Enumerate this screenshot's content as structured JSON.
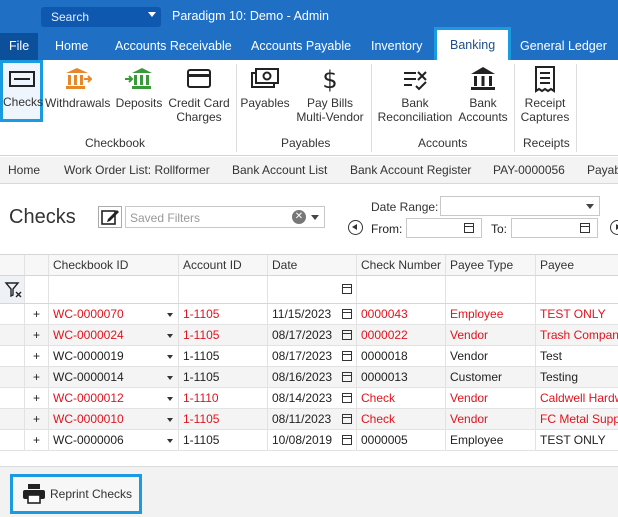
{
  "header": {
    "search_label": "Search",
    "app_title": "Paradigm 10: Demo - Admin"
  },
  "menu": {
    "items": [
      "File",
      "Home",
      "Accounts Receivable",
      "Accounts Payable",
      "Inventory",
      "Banking",
      "General Ledger"
    ],
    "active": "Banking"
  },
  "ribbon": {
    "buttons": [
      {
        "label": "Checks"
      },
      {
        "label": "Withdrawals"
      },
      {
        "label": "Deposits"
      },
      {
        "label": "Credit Card",
        "label2": "Charges"
      },
      {
        "label": "Payables"
      },
      {
        "label": "Pay Bills",
        "label2": "Multi-Vendor"
      },
      {
        "label": "Bank",
        "label2": "Reconciliation"
      },
      {
        "label": "Bank",
        "label2": "Accounts"
      },
      {
        "label": "Receipt",
        "label2": "Captures"
      }
    ],
    "groups": [
      "Checkbook",
      "Payables",
      "Accounts",
      "Receipts"
    ]
  },
  "breadcrumbs": [
    "Home",
    "Work Order List: Rollformer",
    "Bank Account List",
    "Bank Account Register",
    "PAY-0000056",
    "Payab"
  ],
  "page": {
    "title": "Checks",
    "filters_placeholder": "Saved Filters",
    "date_range_label": "Date Range:",
    "from_label": "From:",
    "to_label": "To:"
  },
  "grid": {
    "columns": [
      "Checkbook ID",
      "Account ID",
      "Date",
      "Check Number",
      "Payee Type",
      "Payee"
    ],
    "rows": [
      {
        "checkbook": "WC-0000070",
        "account": "1-1105",
        "date": "11/15/2023",
        "check": "0000043",
        "payee_type": "Employee",
        "payee": "TEST ONLY",
        "red": true
      },
      {
        "checkbook": "WC-0000024",
        "account": "1-1105",
        "date": "08/17/2023",
        "check": "0000022",
        "payee_type": "Vendor",
        "payee": "Trash Company",
        "red": true
      },
      {
        "checkbook": "WC-0000019",
        "account": "1-1105",
        "date": "08/17/2023",
        "check": "0000018",
        "payee_type": "Vendor",
        "payee": "Test",
        "red": false
      },
      {
        "checkbook": "WC-0000014",
        "account": "1-1105",
        "date": "08/16/2023",
        "check": "0000013",
        "payee_type": "Customer",
        "payee": "Testing",
        "red": false
      },
      {
        "checkbook": "WC-0000012",
        "account": "1-1110",
        "date": "08/14/2023",
        "check": "Check",
        "payee_type": "Vendor",
        "payee": "Caldwell Hardw",
        "red": true
      },
      {
        "checkbook": "WC-0000010",
        "account": "1-1105",
        "date": "08/11/2023",
        "check": "Check",
        "payee_type": "Vendor",
        "payee": "FC Metal Supp",
        "red": true
      },
      {
        "checkbook": "WC-0000006",
        "account": "1-1105",
        "date": "10/08/2019",
        "check": "0000005",
        "payee_type": "Employee",
        "payee": "TEST  ONLY",
        "red": false
      }
    ]
  },
  "footer": {
    "reprint_label": "Reprint Checks"
  },
  "colors": {
    "brand_blue": "#1f6fc5",
    "highlight": "#1a9ae0",
    "void_red": "#e0141e"
  }
}
